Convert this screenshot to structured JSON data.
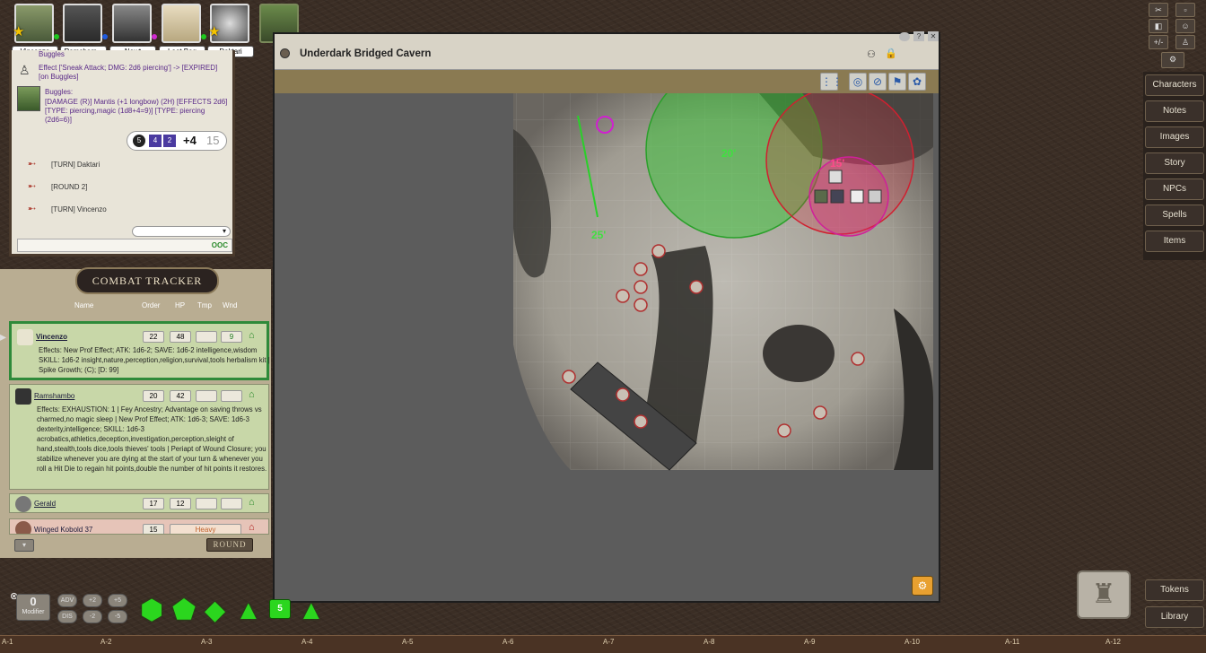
{
  "portraits": [
    {
      "name": "Vincenzo",
      "star": true,
      "dot": "#1ec81e"
    },
    {
      "name": "Ramsham...",
      "star": false,
      "dot": "#1f5be0"
    },
    {
      "name": "Newt",
      "star": false,
      "dot": "#d02ad0"
    },
    {
      "name": "Loot Bag",
      "star": false,
      "dot": "#1ec81e"
    },
    {
      "name": "Daktari",
      "star": true,
      "dot": ""
    }
  ],
  "chat": {
    "top_line": "Buggles",
    "effect_line": "Effect ['Sneak Attack; DMG: 2d6 piercing'] -> [EXPIRED] [on Buggles]",
    "attacker": "Buggles:",
    "damage_line": "[DAMAGE (R)] Mantis (+1 longbow) (2H) [EFFECTS 2d6] [TYPE: piercing,magic (1d8+4=9)] [TYPE: piercing (2d6=6)]",
    "dice": {
      "d1": "5",
      "d2": "4",
      "d3": "2",
      "mod": "+4",
      "total": "15"
    },
    "turns": [
      "[TURN] Daktari",
      "[ROUND 2]",
      "[TURN] Vincenzo"
    ],
    "ooc": "OOC"
  },
  "combat": {
    "title": "COMBAT TRACKER",
    "headers": {
      "name": "Name",
      "order": "Order",
      "hp": "HP",
      "tmp": "Tmp",
      "wnd": "Wnd"
    },
    "entries": [
      {
        "name": "Vincenzo",
        "order": "22",
        "hp": "48",
        "tmp": "",
        "wnd": "9",
        "effects": "Effects: New Prof Effect; ATK: 1d6-2; SAVE: 1d6-2 intelligence,wisdom SKILL: 1d6-2 insight,nature,perception,religion,survival,tools herbalism kit | Spike Growth; (C); [D: 99]"
      },
      {
        "name": "Ramshambo",
        "order": "20",
        "hp": "42",
        "tmp": "",
        "wnd": "",
        "effects": "Effects: EXHAUSTION: 1 | Fey Ancestry; Advantage on saving throws vs charmed,no magic sleep | New Prof Effect; ATK: 1d6-3; SAVE: 1d6-3 dexterity,intelligence; SKILL: 1d6-3 acrobatics,athletics,deception,investigation,perception,sleight of hand,stealth,tools dice,tools thieves' tools | Periapt of Wound Closure; you stabilize whenever you are dying at the start of your turn & whenever you roll a Hit Die to regain hit points,double the number of hit points it restores."
      },
      {
        "name": "Gerald",
        "order": "17",
        "hp": "12",
        "tmp": "",
        "wnd": "",
        "effects": ""
      },
      {
        "name": "Winged Kobold 37",
        "order": "15",
        "hp": "",
        "tmp": "",
        "wnd": "Heavy",
        "effects": ""
      }
    ],
    "round_label": "ROUND"
  },
  "map": {
    "title": "Underdark Bridged Cavern",
    "labels": [
      "20'",
      "15'",
      "25'"
    ]
  },
  "nav": [
    "Characters",
    "Notes",
    "Images",
    "Story",
    "NPCs",
    "Spells",
    "Items"
  ],
  "nav_bottom": [
    "Tokens",
    "Library"
  ],
  "top_right": {
    "plus_minus": "+/-"
  },
  "dicebar": {
    "modifier_value": "0",
    "modifier_label": "Modifier",
    "buttons": [
      "ADV",
      "+2",
      "+5",
      "DIS",
      "-2",
      "-5"
    ],
    "d6": "5"
  },
  "ruler": [
    "A-1",
    "A-2",
    "A-3",
    "A-4",
    "A-5",
    "A-6",
    "A-7",
    "A-8",
    "A-9",
    "A-10",
    "A-11",
    "A-12"
  ]
}
